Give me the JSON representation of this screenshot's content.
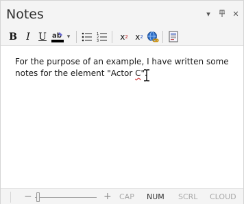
{
  "panel": {
    "title": "Notes",
    "controls": {
      "dropdown": "▾",
      "pin": "⊥",
      "close": "✕"
    }
  },
  "toolbar": {
    "bold": "B",
    "italic": "I",
    "underline": "U",
    "font_color_swatch": "#000000",
    "superscript_base": "x",
    "superscript_exp": "2",
    "subscript_base": "x",
    "subscript_exp": "2"
  },
  "editor": {
    "line1": "For the purpose of an example, I have written some",
    "line2_prefix": "notes for the element \"Actor ",
    "line2_misspelled": "C",
    "line2_suffix": "\"."
  },
  "status_bar": {
    "zoom_minus": "−",
    "zoom_plus": "+",
    "zoom_level": 0.05,
    "cap": "CAP",
    "num": "NUM",
    "scrl": "SCRL",
    "cloud": "CLOUD"
  },
  "colors": {
    "chrome_bg": "#f4f4f4",
    "editor_bg": "#ffffff",
    "text": "#1a1a1a",
    "status_inactive": "#a8a8a8",
    "status_active": "#333333",
    "spell_error": "#d13a3a"
  }
}
